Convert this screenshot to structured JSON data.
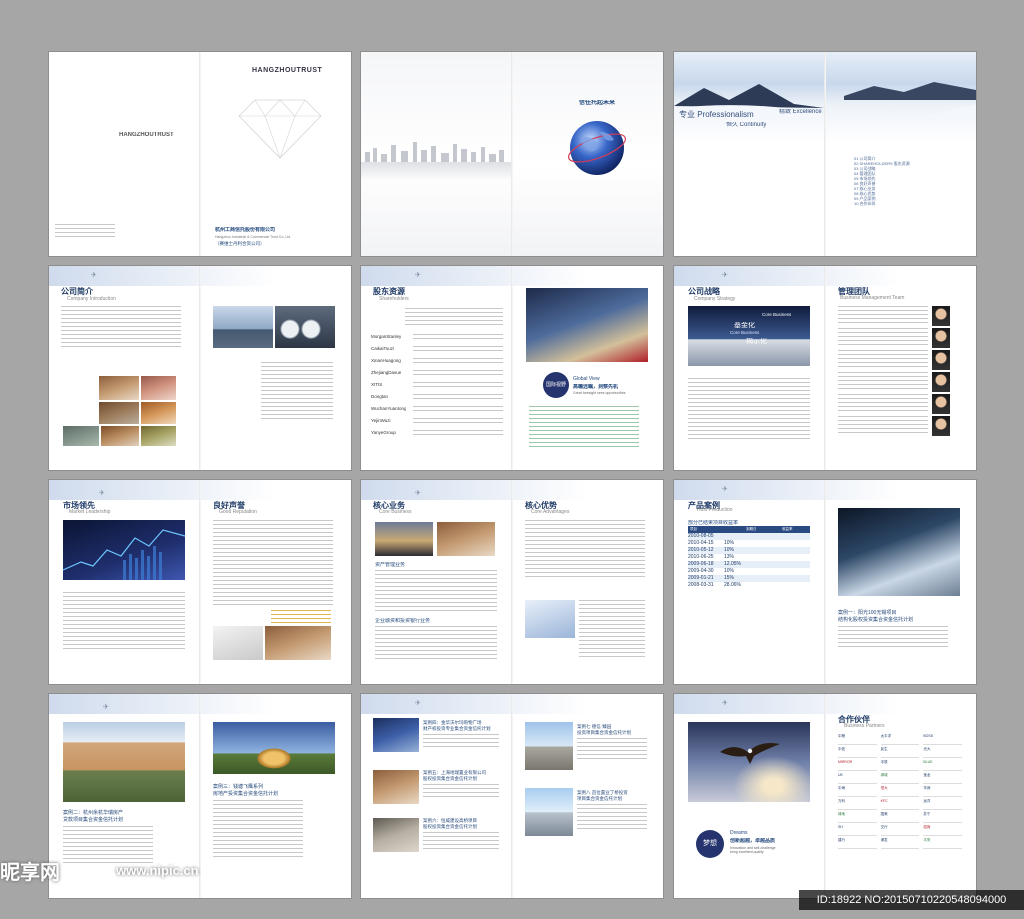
{
  "watermark": {
    "site": "昵享网",
    "url": "www.nipic.cn",
    "id_tag": "ID:18922 NO:20150710220548094000"
  },
  "cover": {
    "brand": "HANGZHOUTRUST",
    "company_cn": "杭州工商信托股份有限公司",
    "company_en": "Hangzhou Industrial & Commercial Trust Co.,Ltd.",
    "note": "（赛维士丹利合资公司）",
    "future": "信任托起未来",
    "mission": {
      "a": "专业 Professionalism",
      "b": "精致 Excellence",
      "c": "恒久 Continuity"
    },
    "index": [
      "01 公司简介",
      "02 SHAREHOLDERS 股东资源",
      "03 公司战略",
      "04 管理团队",
      "05 市场领先",
      "06 良好声誉",
      "07 核心业务",
      "08 核心优势",
      "09 产品案例",
      "10 合作伙伴"
    ]
  },
  "page2": {
    "intro_title": "公司简介",
    "intro_sub": "Company Introduction",
    "sh_title": "股东资源",
    "sh_sub": "Shareholders",
    "shareholders": [
      "MorganStanley",
      "CaikaiTouzi",
      "XinanHuagong",
      "ZhejiangDasue",
      "XITIS",
      "Dongtan",
      "WuchanYuantong",
      "YejinWuzi",
      "YanyeGroup"
    ],
    "global_badge": "国际视野",
    "global_en": "Global View",
    "global_cn": "高瞻远瞩，洞察先机",
    "global_sub": "Great foresight sees opportunities",
    "strategy_title": "公司战略",
    "strategy_sub": "Company Strategy",
    "strategy_words": [
      "Core Business",
      "基金化",
      "Core Business",
      "揭示化"
    ],
    "team_title": "管理团队",
    "team_sub": "Business Management Team"
  },
  "page3": {
    "market_title": "市场领先",
    "market_sub": "Market Leadership",
    "rep_title": "良好声誉",
    "rep_sub": "Good Reputation",
    "core_title": "核心业务",
    "core_sub": "Core Business",
    "adv_title": "核心优势",
    "adv_sub": "Core Advantages",
    "asset_mgmt": "资产管理业务",
    "ent_fin": "企业融资和投资银行业务",
    "prod_title": "产品案例",
    "prod_sub": "Trust Production",
    "table_title": "部分已结束项目收益率",
    "table_headers": [
      "项目",
      "到期日",
      "收益率"
    ],
    "table_rows": [
      [
        "2010-08-05",
        ""
      ],
      [
        "2010-04-15",
        "10%"
      ],
      [
        "2010-05-12",
        "10%"
      ],
      [
        "2010-06-25",
        "13%"
      ],
      [
        "2009-06-18",
        "12.05%"
      ],
      [
        "2009-04-30",
        "10%"
      ],
      [
        "2009-01-21",
        "15%"
      ],
      [
        "2008-03-31",
        "28.06%"
      ]
    ],
    "case1": "案例一：阳光100无锡项目\n结构化股权投资集合资金信托计划"
  },
  "page4": {
    "case2": "案例二：杭州余杭华瑞房产\n贷款项目集合资金信托计划",
    "case3": "案例三：钱塘飞鹰系列\n房地产投资集合资金信托计划",
    "case4": "案例四：金华沃尔玛购物广场\n财产权投资专业集合资金信托计划",
    "case5": "案例五：上海地瑞置业有限公司\n股权投资集合资金信托计划",
    "case6": "案例六：恒威建设高桥项目\n股权投资集合资金信托计划",
    "case7": "案例七 德信·臻园\n投资项目集合资金信托计划",
    "case8": "案例八 首位置业丁桥投资\n项目集合资金信托计划",
    "dream_badge": "梦想",
    "dream_en": "Dreams",
    "dream_cn": "创新超越，卓越品质",
    "dream_sub": "Innovation and self-challenge\nbring excellent quality",
    "partners_title": "合作伙伴",
    "partners_sub": "Business Partners",
    "partners": [
      "中粮",
      "太平洋",
      "BOSS",
      "中信",
      "民生",
      "光大",
      "MIRROR",
      "中铁",
      "BLUE",
      "UK",
      "绿城",
      "宝龙",
      "中海",
      "恒大",
      "华润",
      "万科",
      "KFC",
      "远洋",
      "绿地",
      "国美",
      "苏宁",
      "SH",
      "交行",
      "招商",
      "建行",
      "浦发",
      "平安"
    ]
  }
}
